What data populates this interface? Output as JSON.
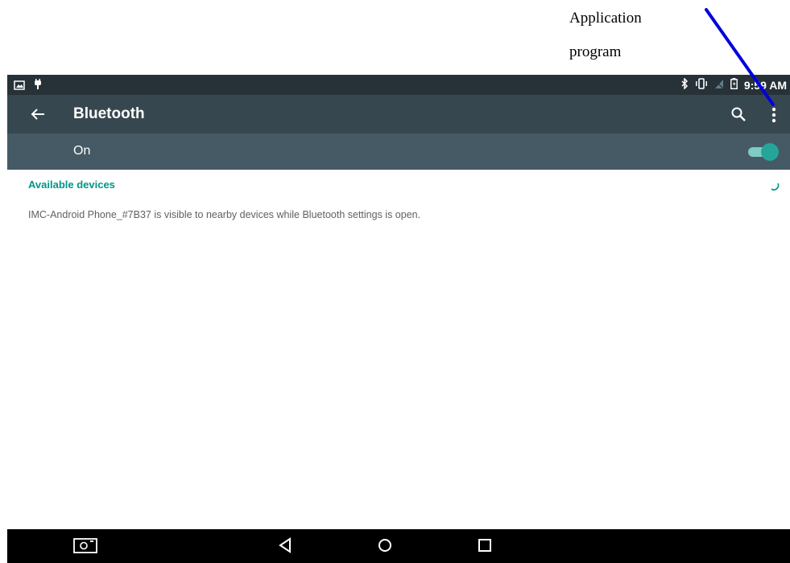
{
  "annotation": {
    "line1": "Application",
    "line2": "program",
    "arrow_color": "#0000dd"
  },
  "status_bar": {
    "left_icons": [
      "image-icon",
      "usb-debug-icon"
    ],
    "right_icons": [
      "bluetooth-icon",
      "vibrate-icon",
      "no-signal-icon",
      "battery-icon"
    ],
    "time": "9:59 AM"
  },
  "toolbar": {
    "title": "Bluetooth",
    "back_icon": "arrow-back-icon",
    "search_icon": "search-icon",
    "menu_icon": "more-vert-icon"
  },
  "switch_bar": {
    "label": "On",
    "toggle_on": true,
    "accent": "#26a69a"
  },
  "content": {
    "category": "Available devices",
    "visibility_text": "IMC-Android Phone_#7B37 is visible to nearby devices while Bluetooth settings is open."
  },
  "nav_bar": {
    "icons": [
      "screenshot-icon",
      "back-icon",
      "home-icon",
      "recents-icon"
    ]
  },
  "colors": {
    "status_bar": "#263238",
    "toolbar": "#37474f",
    "switch_bar": "#455a64",
    "accent": "#009688"
  }
}
